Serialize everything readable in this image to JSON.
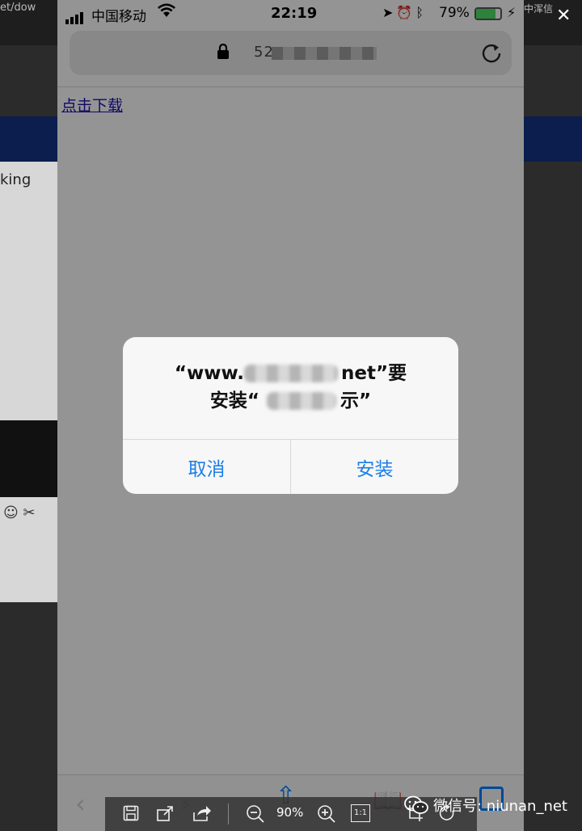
{
  "background": {
    "url_fragment": "et/dow",
    "right_text": "中浑信",
    "side_text": "king",
    "close_glyph": "✕"
  },
  "status_bar": {
    "carrier": "中国移动",
    "time": "22:19",
    "battery_percent": "79%",
    "battery_level": 0.79
  },
  "address_bar": {
    "url_visible": "52",
    "lock_icon": "lock-icon",
    "reload_icon": "reload-icon"
  },
  "page": {
    "download_link": "点击下载"
  },
  "alert": {
    "title_line1_prefix": "“www.",
    "title_line1_suffix": "net”要",
    "title_line2_prefix": "安装“",
    "title_line2_suffix": "示”",
    "cancel_label": "取消",
    "install_label": "安装"
  },
  "viewer_toolbar": {
    "zoom": "90%",
    "one_to_one": "1:1"
  },
  "watermark": {
    "text": "微信号: niunan_net"
  },
  "colors": {
    "alert_button": "#1a7ee8",
    "link": "#1a0dab",
    "ios_blue": "#007aff",
    "battery": "#4cd964"
  }
}
